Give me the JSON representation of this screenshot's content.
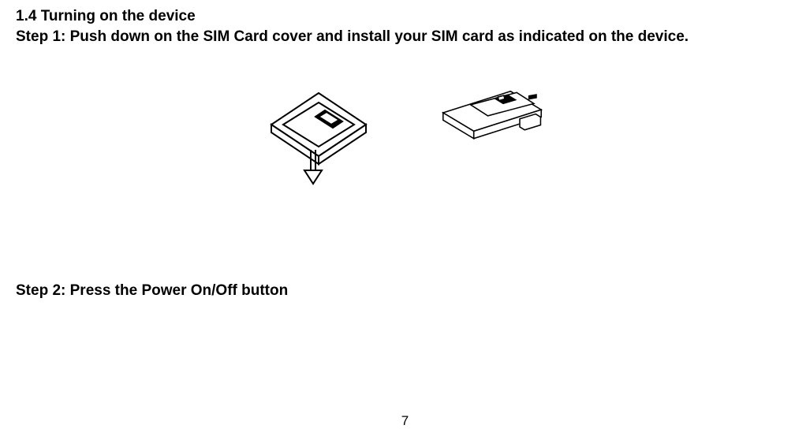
{
  "section_heading": "1.4 Turning on the device",
  "step1": "Step 1: Push down on the SIM Card cover and install your SIM card as indicated on the device.",
  "step2": "Step 2: Press the Power On/Off button",
  "page_number": "7",
  "illustrations": {
    "left_alt": "device-top-view-sim-cover-push-down",
    "right_alt": "device-angled-view-sim-card-install"
  }
}
